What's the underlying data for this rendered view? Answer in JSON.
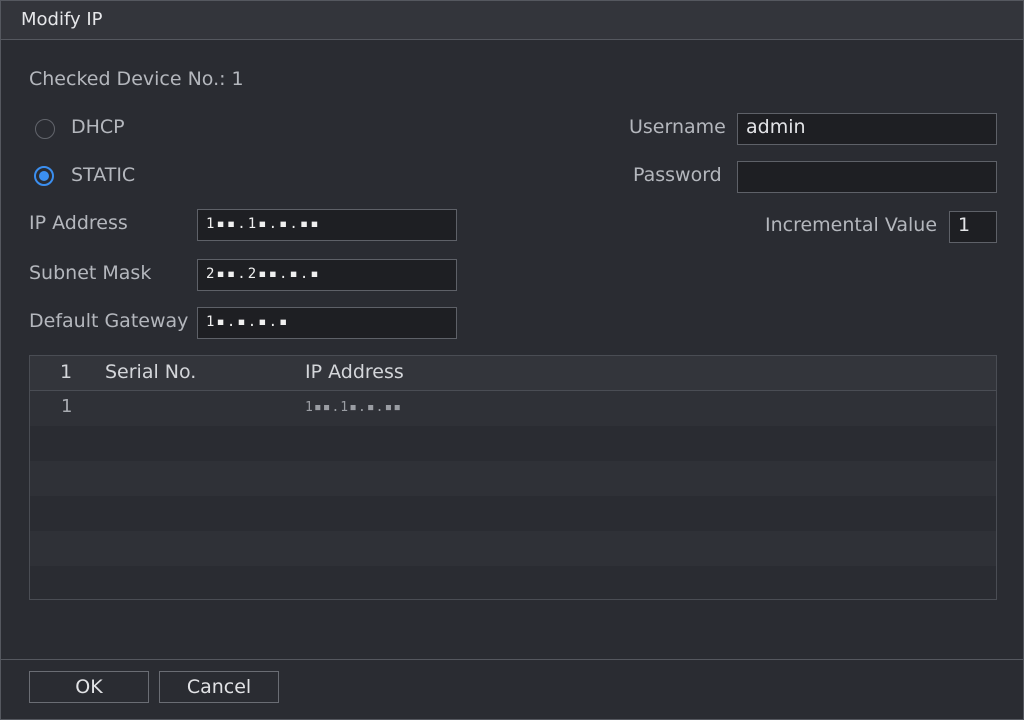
{
  "dialog": {
    "title": "Modify IP"
  },
  "checked_device": "Checked Device No.: 1",
  "mode": {
    "dhcp_label": "DHCP",
    "static_label": "STATIC",
    "selected": "STATIC"
  },
  "network": {
    "ip_label": "IP Address",
    "ip_value": "1▪▪.1▪.▪.▪▪",
    "subnet_label": "Subnet Mask",
    "subnet_value": "2▪▪.2▪▪.▪.▪",
    "gateway_label": "Default Gateway",
    "gateway_value": "1▪.▪.▪.▪"
  },
  "auth": {
    "username_label": "Username",
    "username_value": "admin",
    "password_label": "Password",
    "password_value": "",
    "incremental_label": "Incremental Value",
    "incremental_value": "1"
  },
  "table": {
    "columns": [
      "1",
      "Serial No.",
      "IP Address"
    ],
    "rows": [
      {
        "index": "1",
        "serial": "",
        "ip": "1▪▪.1▪.▪.▪▪"
      }
    ]
  },
  "buttons": {
    "ok": "OK",
    "cancel": "Cancel"
  },
  "colors": {
    "accent": "#3b8ff0",
    "background": "#2a2c32",
    "header": "#33353b"
  }
}
